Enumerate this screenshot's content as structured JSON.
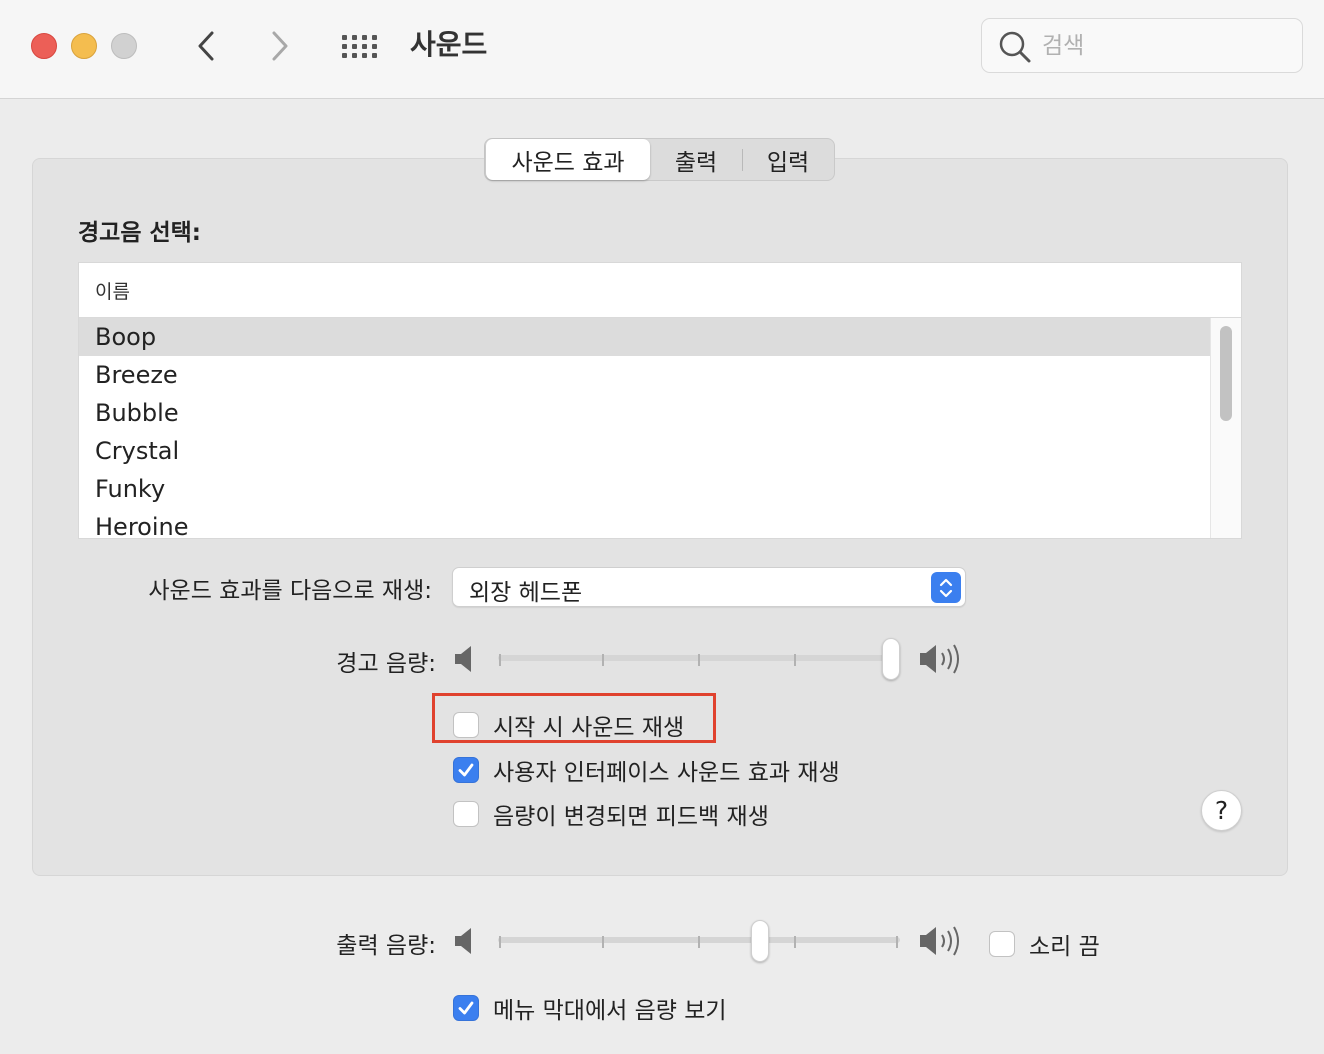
{
  "window": {
    "title": "사운드",
    "search_placeholder": "검색"
  },
  "tabs": [
    {
      "label": "사운드 효과",
      "active": true
    },
    {
      "label": "출력",
      "active": false
    },
    {
      "label": "입력",
      "active": false
    }
  ],
  "alert_section": {
    "label": "경고음 선택:",
    "column_header": "이름",
    "sounds": [
      "Boop",
      "Breeze",
      "Bubble",
      "Crystal",
      "Funky",
      "Heroine"
    ],
    "selected": "Boop"
  },
  "play_through": {
    "label": "사운드 효과를 다음으로 재생:",
    "value": "외장 헤드폰"
  },
  "alert_volume": {
    "label": "경고 음량:",
    "level_fraction": 1.0
  },
  "checkboxes": {
    "startup_sound": {
      "label": "시작 시 사운드 재생",
      "checked": false
    },
    "ui_sound": {
      "label": "사용자 인터페이스 사운드 효과 재생",
      "checked": true
    },
    "volume_feedback": {
      "label": "음량이 변경되면 피드백 재생",
      "checked": false
    }
  },
  "help_label": "?",
  "output_volume": {
    "label": "출력 음량:",
    "level_fraction": 0.66,
    "mute_label": "소리 끔",
    "mute_checked": false
  },
  "menu_bar_volume": {
    "label": "메뉴 막대에서 음량 보기",
    "checked": true
  },
  "colors": {
    "accent": "#3b7fef",
    "highlight": "#e0422e"
  }
}
